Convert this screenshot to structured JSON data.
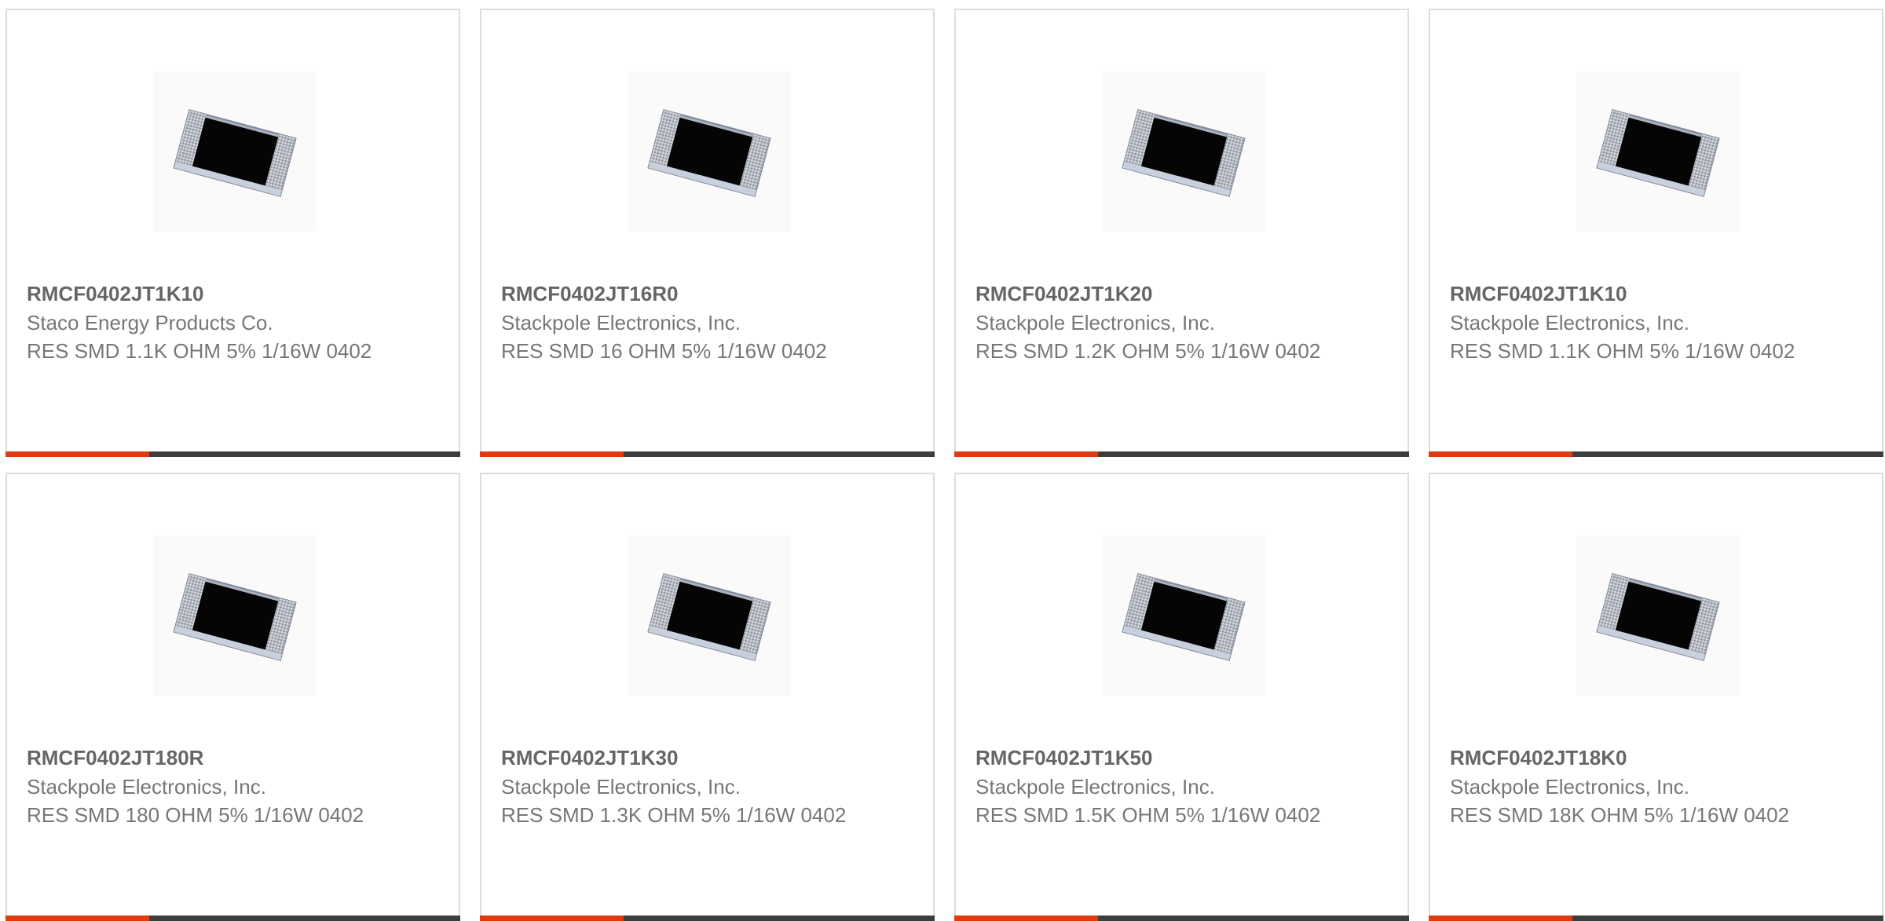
{
  "colors": {
    "accent": "#e03a0f",
    "bar": "#3d3d3d",
    "border": "#dddddd",
    "text": "#777777"
  },
  "products": [
    {
      "part_number": "RMCF0402JT1K10",
      "manufacturer": "Staco Energy Products Co.",
      "description": "RES SMD 1.1K OHM 5% 1/16W 0402",
      "image_icon": "chip-resistor-image"
    },
    {
      "part_number": "RMCF0402JT16R0",
      "manufacturer": "Stackpole Electronics, Inc.",
      "description": "RES SMD 16 OHM 5% 1/16W 0402",
      "image_icon": "chip-resistor-image"
    },
    {
      "part_number": "RMCF0402JT1K20",
      "manufacturer": "Stackpole Electronics, Inc.",
      "description": "RES SMD 1.2K OHM 5% 1/16W 0402",
      "image_icon": "chip-resistor-image"
    },
    {
      "part_number": "RMCF0402JT1K10",
      "manufacturer": "Stackpole Electronics, Inc.",
      "description": "RES SMD 1.1K OHM 5% 1/16W 0402",
      "image_icon": "chip-resistor-image"
    },
    {
      "part_number": "RMCF0402JT180R",
      "manufacturer": "Stackpole Electronics, Inc.",
      "description": "RES SMD 180 OHM 5% 1/16W 0402",
      "image_icon": "chip-resistor-image"
    },
    {
      "part_number": "RMCF0402JT1K30",
      "manufacturer": "Stackpole Electronics, Inc.",
      "description": "RES SMD 1.3K OHM 5% 1/16W 0402",
      "image_icon": "chip-resistor-image"
    },
    {
      "part_number": "RMCF0402JT1K50",
      "manufacturer": "Stackpole Electronics, Inc.",
      "description": "RES SMD 1.5K OHM 5% 1/16W 0402",
      "image_icon": "chip-resistor-image"
    },
    {
      "part_number": "RMCF0402JT18K0",
      "manufacturer": "Stackpole Electronics, Inc.",
      "description": "RES SMD 18K OHM 5% 1/16W 0402",
      "image_icon": "chip-resistor-image"
    }
  ]
}
